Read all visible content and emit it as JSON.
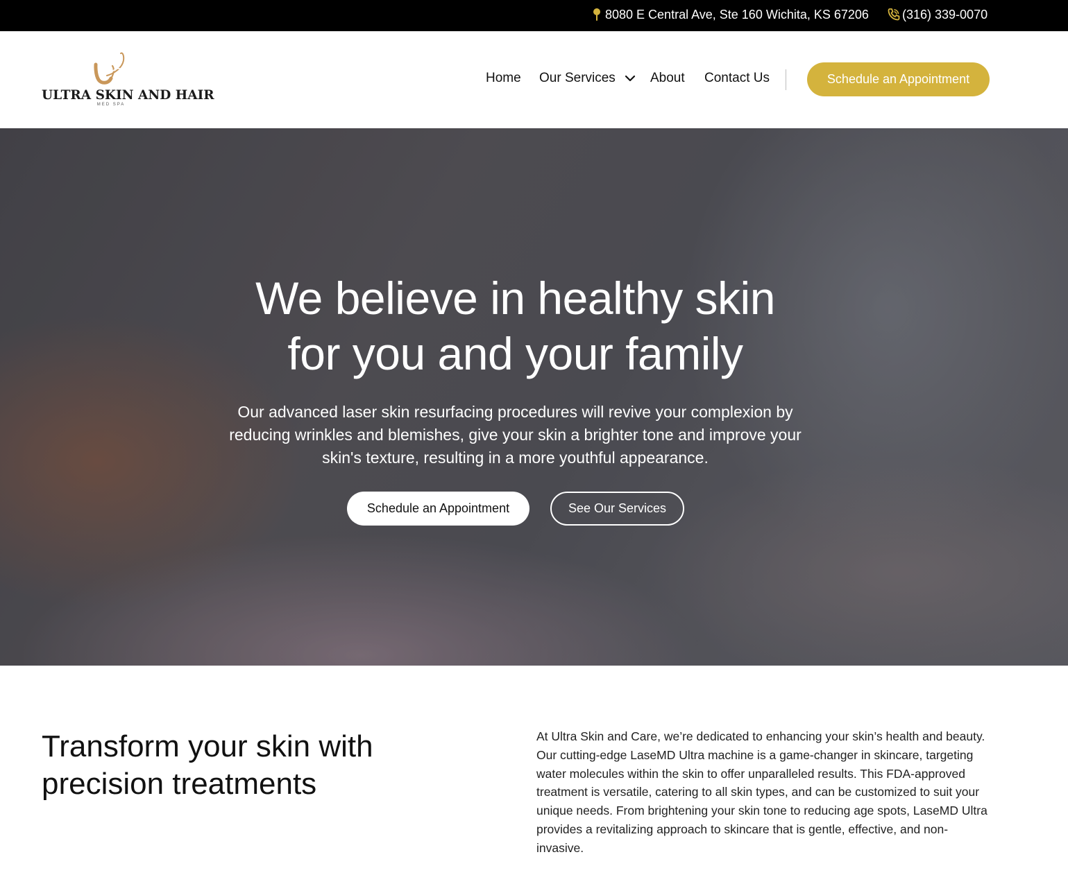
{
  "topbar": {
    "address": "8080 E Central Ave, Ste 160 Wichita, KS 67206",
    "address_icon": "map-pin-icon",
    "phone": "(316) 339-0070",
    "phone_icon": "phone-icon",
    "icon_color": "#d4b33d"
  },
  "header": {
    "logo": {
      "brand": "ULTRA SKIN AND HAIR",
      "sub": "MED SPA"
    },
    "nav": {
      "home": "Home",
      "services": "Our Services",
      "about": "About",
      "contact": "Contact Us"
    },
    "cta": "Schedule an Appointment"
  },
  "hero": {
    "title_line1": "We believe in healthy skin",
    "title_line2": "for you and your family",
    "lead": "Our advanced laser skin resurfacing procedures will revive your complexion by reducing wrinkles and blemishes, give your skin a brighter tone and improve your skin's texture, resulting in a more youthful appearance.",
    "primary_button": "Schedule an Appointment",
    "secondary_button": "See Our Services"
  },
  "intro": {
    "title": "Transform your skin with precision treatments",
    "body": "At Ultra Skin and Care, we’re dedicated to enhancing your skin’s health and beauty. Our cutting-edge LaseMD Ultra machine is a game-changer in skincare, targeting water molecules within the skin to offer unparalleled results. This FDA-approved treatment is versatile, catering to all skin types, and can be customized to suit your unique needs. From brightening your skin tone to reducing age spots, LaseMD Ultra provides a revitalizing approach to skincare that is gentle, effective, and non-invasive."
  },
  "colors": {
    "accent": "#d4b33d",
    "logo_gold": "#c9975a",
    "topbar_bg": "#000000"
  }
}
